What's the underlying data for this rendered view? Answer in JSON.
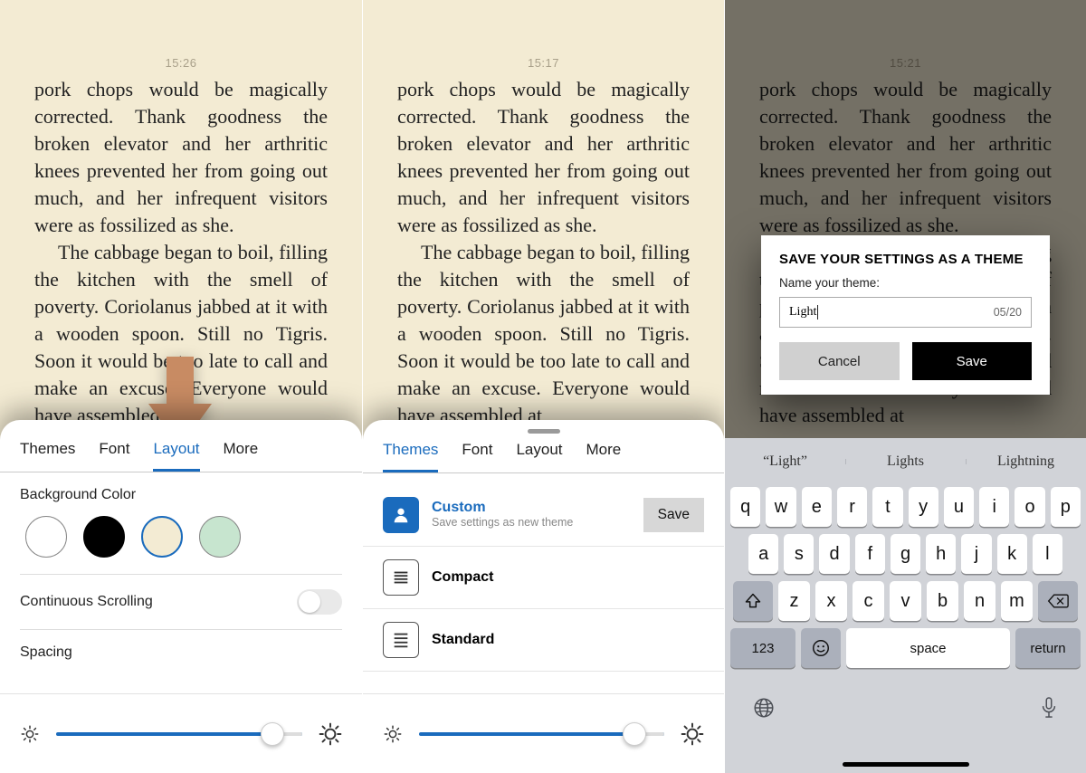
{
  "screens": {
    "s1": {
      "time": "15:26"
    },
    "s2": {
      "time": "15:17"
    },
    "s3": {
      "time": "15:21"
    }
  },
  "book": {
    "p1": "pork chops would be magically corrected. Thank goodness the broken elevator and her arthritic knees prevented her from going out much, and her infrequent vis­itors were as fossilized as she.",
    "p2": "The cabbage began to boil, fill­ing the kitchen with the smell of poverty. Coriolanus jabbed at it with a wooden spoon. Still no Ti­gris. Soon it would be too late to call and make an excuse. Every­one would have assembled at"
  },
  "tabs": {
    "themes": "Themes",
    "font": "Font",
    "layout": "Layout",
    "more": "More"
  },
  "layout_panel": {
    "bg_title": "Background Color",
    "scroll_label": "Continuous Scrolling",
    "spacing_label": "Spacing"
  },
  "themes_panel": {
    "custom": {
      "title": "Custom",
      "sub": "Save settings as new theme",
      "save_btn": "Save"
    },
    "compact": "Compact",
    "standard": "Standard"
  },
  "save_modal": {
    "title": "SAVE YOUR SETTINGS AS A THEME",
    "subtitle": "Name your theme:",
    "value": "Light",
    "counter": "05/20",
    "cancel": "Cancel",
    "save": "Save"
  },
  "keyboard": {
    "suggestions": [
      "“Light”",
      "Lights",
      "Lightning"
    ],
    "row1": [
      "q",
      "w",
      "e",
      "r",
      "t",
      "y",
      "u",
      "i",
      "o",
      "p"
    ],
    "row2": [
      "a",
      "s",
      "d",
      "f",
      "g",
      "h",
      "j",
      "k",
      "l"
    ],
    "row3": [
      "z",
      "x",
      "c",
      "v",
      "b",
      "n",
      "m"
    ],
    "num_key": "123",
    "space_key": "space",
    "return_key": "return"
  }
}
